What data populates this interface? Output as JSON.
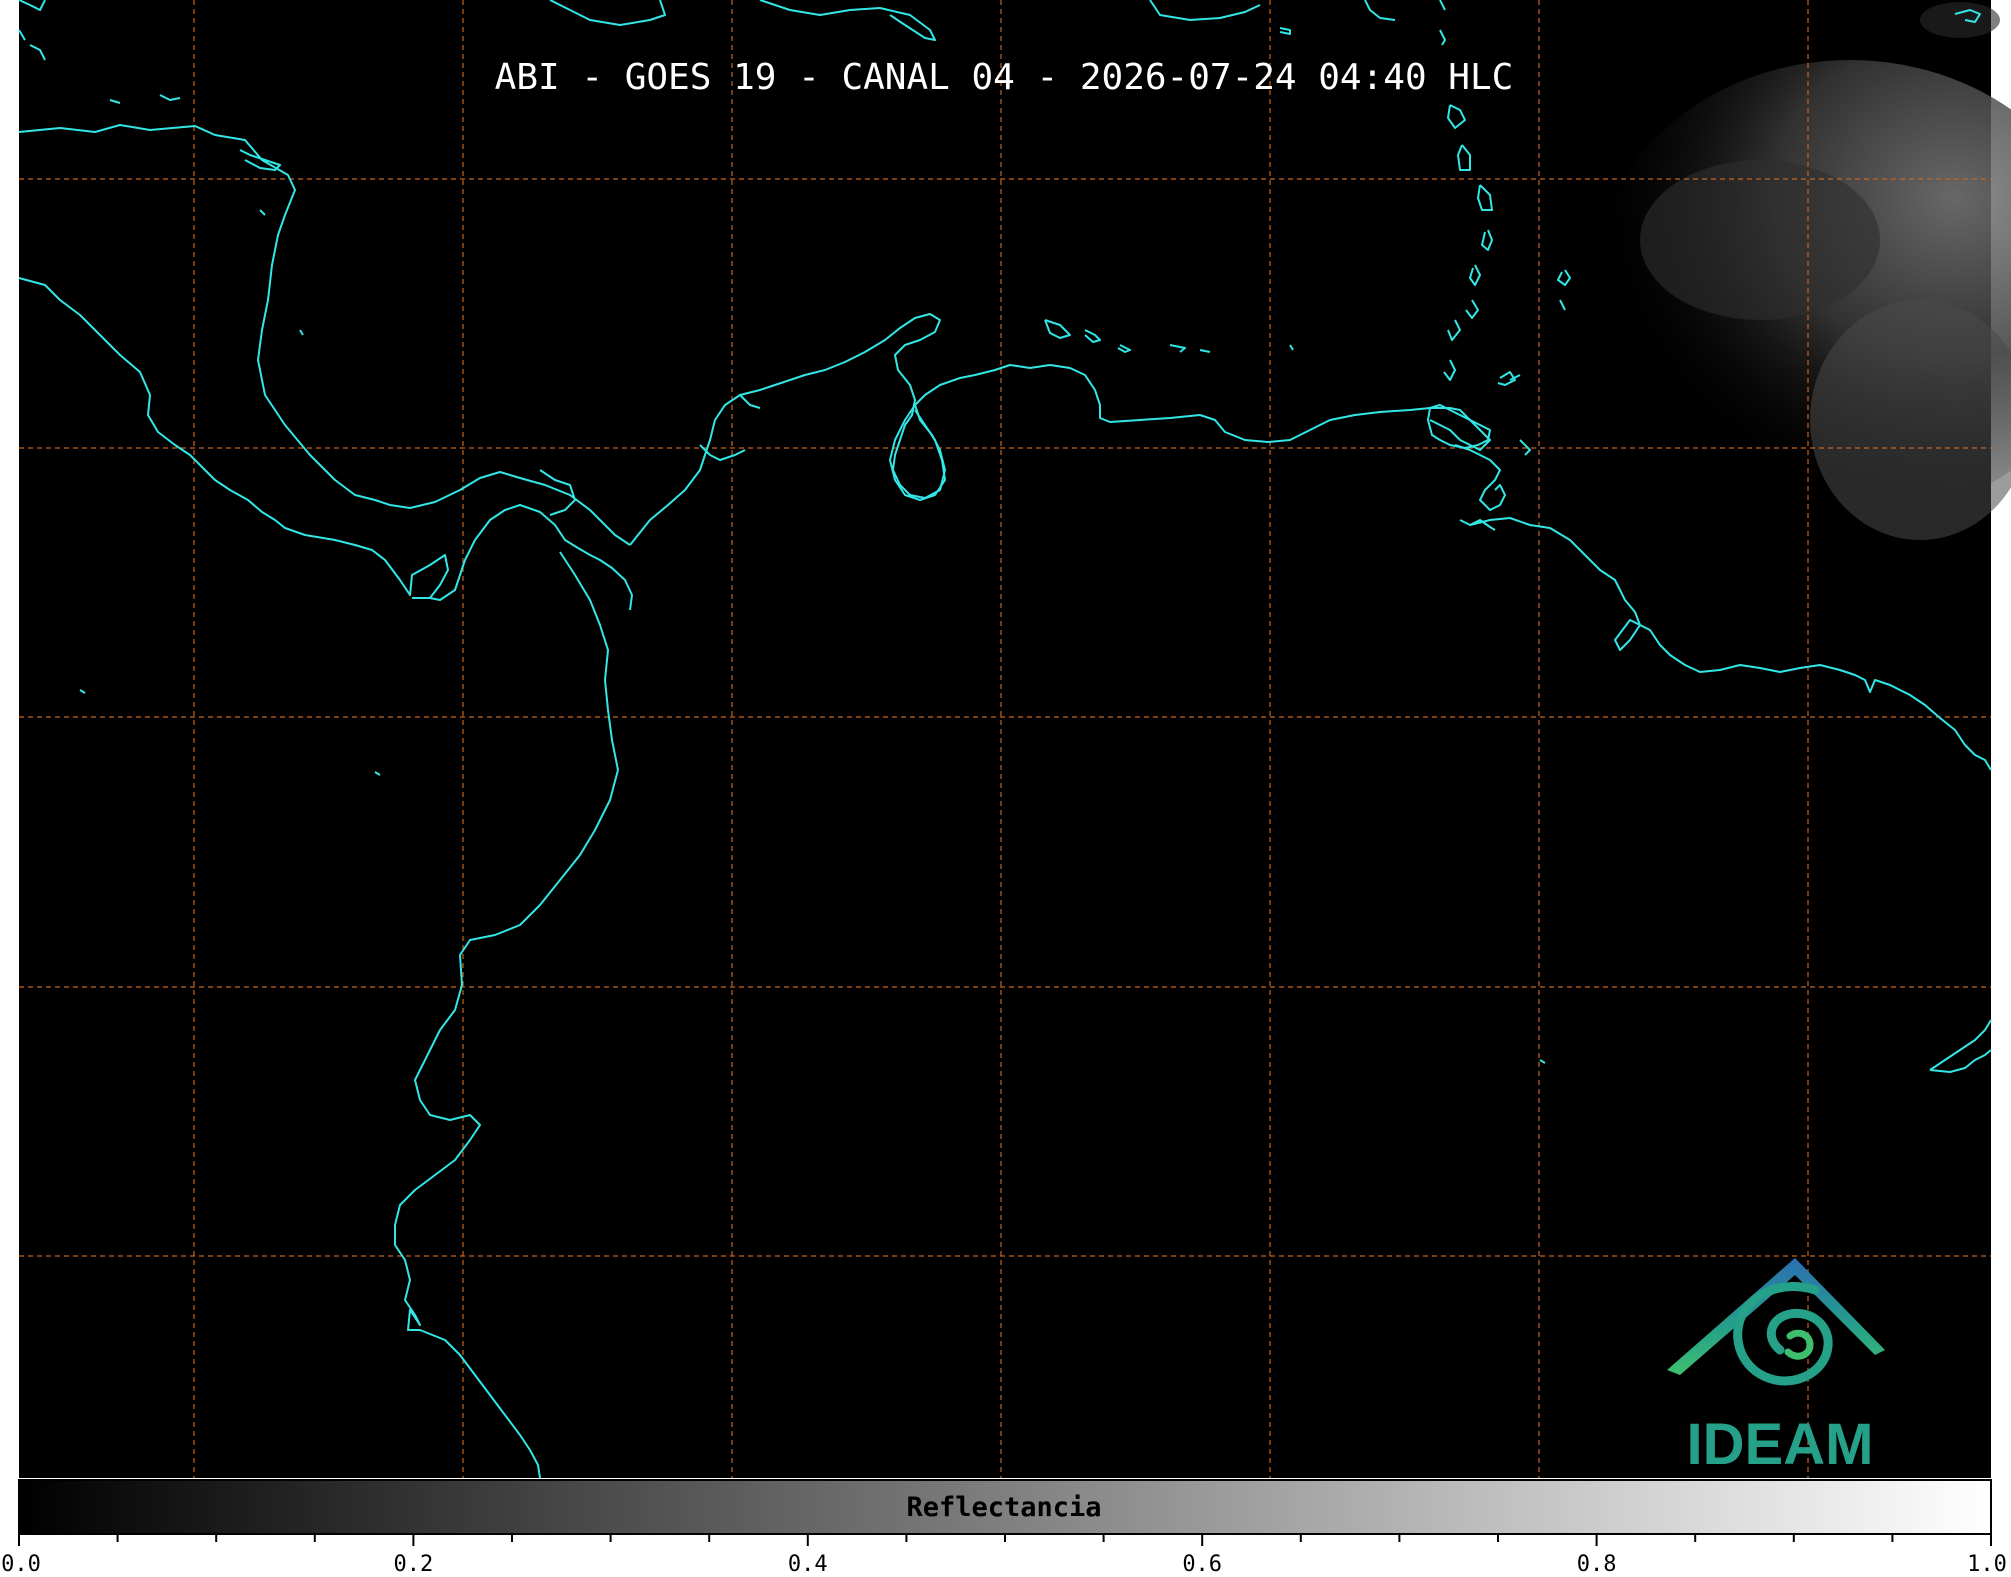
{
  "title": "ABI - GOES 19 - CANAL 04 - 2026-07-24 04:40 HLC",
  "colorbar": {
    "label": "Reflectancia",
    "ticks": [
      "0.0",
      "0.2",
      "0.4",
      "0.6",
      "0.8",
      "1.0"
    ],
    "range": [
      0.0,
      1.0
    ],
    "colormap_start": "#000000",
    "colormap_end": "#ffffff"
  },
  "map": {
    "background": "#000000",
    "coastline_color": "#33e6e6",
    "gridline_color": "#c8641e",
    "gridline_style": "dashed"
  },
  "logo": {
    "text": "IDEAM",
    "colors": [
      "#2b6fb3",
      "#25a089",
      "#3ebf6e"
    ]
  }
}
